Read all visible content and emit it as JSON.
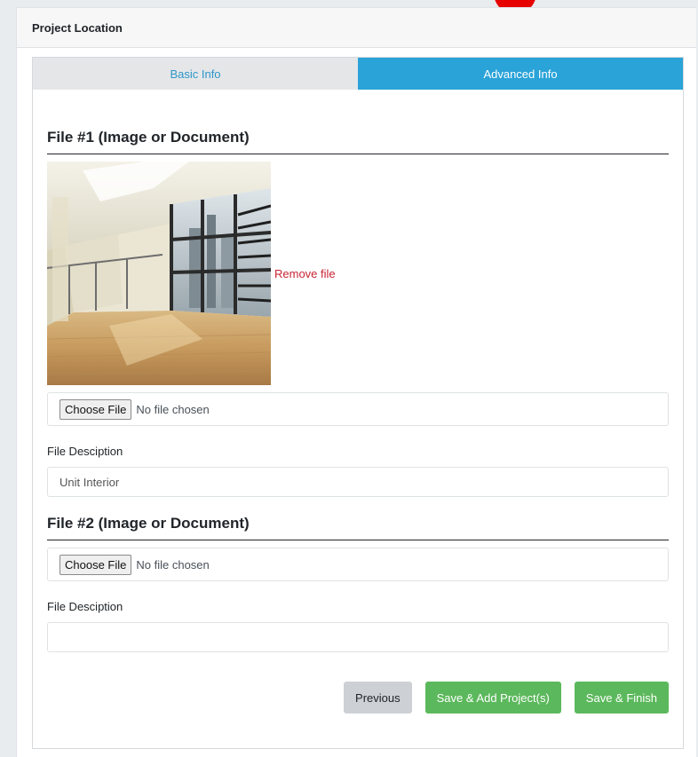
{
  "panel": {
    "title": "Project Location"
  },
  "tabs": [
    {
      "label": "Basic Info",
      "active": false
    },
    {
      "label": "Advanced Info",
      "active": true
    }
  ],
  "files": [
    {
      "heading": "File #1 (Image or Document)",
      "has_preview": true,
      "remove_label": "Remove file",
      "choose_label": "Choose File",
      "status": "No file chosen",
      "description_label": "File Desciption",
      "description_value": "Unit Interior"
    },
    {
      "heading": "File #2 (Image or Document)",
      "has_preview": false,
      "choose_label": "Choose File",
      "status": "No file chosen",
      "description_label": "File Desciption",
      "description_value": ""
    }
  ],
  "actions": {
    "previous": "Previous",
    "save_add": "Save & Add Project(s)",
    "save_finish": "Save & Finish"
  },
  "colors": {
    "tab_active": "#2aa3d8",
    "tab_inactive_text": "#2c97c9",
    "remove_link": "#c82333",
    "green_button": "#5cb85c"
  }
}
